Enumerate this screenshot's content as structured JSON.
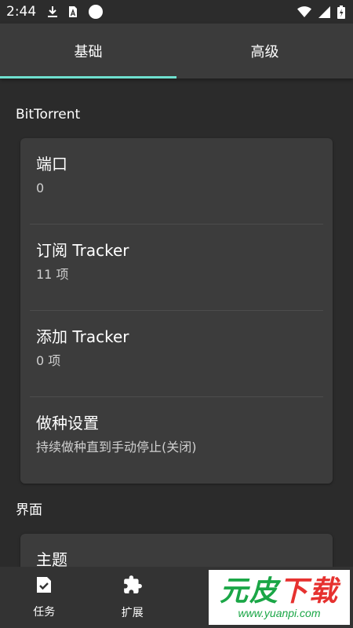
{
  "status_bar": {
    "time": "2:44",
    "left_icons": [
      "download-icon",
      "app-a-icon",
      "circle-icon"
    ],
    "right_icons": [
      "wifi-icon",
      "signal-icon",
      "battery-charging-icon"
    ]
  },
  "tabs": [
    {
      "label": "基础",
      "active": true
    },
    {
      "label": "高级",
      "active": false
    }
  ],
  "accent_color": "#6fe0cf",
  "sections": [
    {
      "header": "BitTorrent",
      "items": [
        {
          "title": "端口",
          "summary": "0"
        },
        {
          "title": "订阅 Tracker",
          "summary": "11 项"
        },
        {
          "title": "添加 Tracker",
          "summary": "0 项"
        },
        {
          "title": "做种设置",
          "summary": "持续做种直到手动停止(关闭)"
        }
      ]
    },
    {
      "header": "界面",
      "items": [
        {
          "title": "主题"
        }
      ]
    }
  ],
  "bottom_nav": [
    {
      "label": "任务",
      "icon": "task-list-icon"
    },
    {
      "label": "扩展",
      "icon": "puzzle-icon"
    }
  ],
  "watermark": {
    "text_green": "元皮",
    "text_red": "下载",
    "url": "www.yuanpi.com"
  }
}
